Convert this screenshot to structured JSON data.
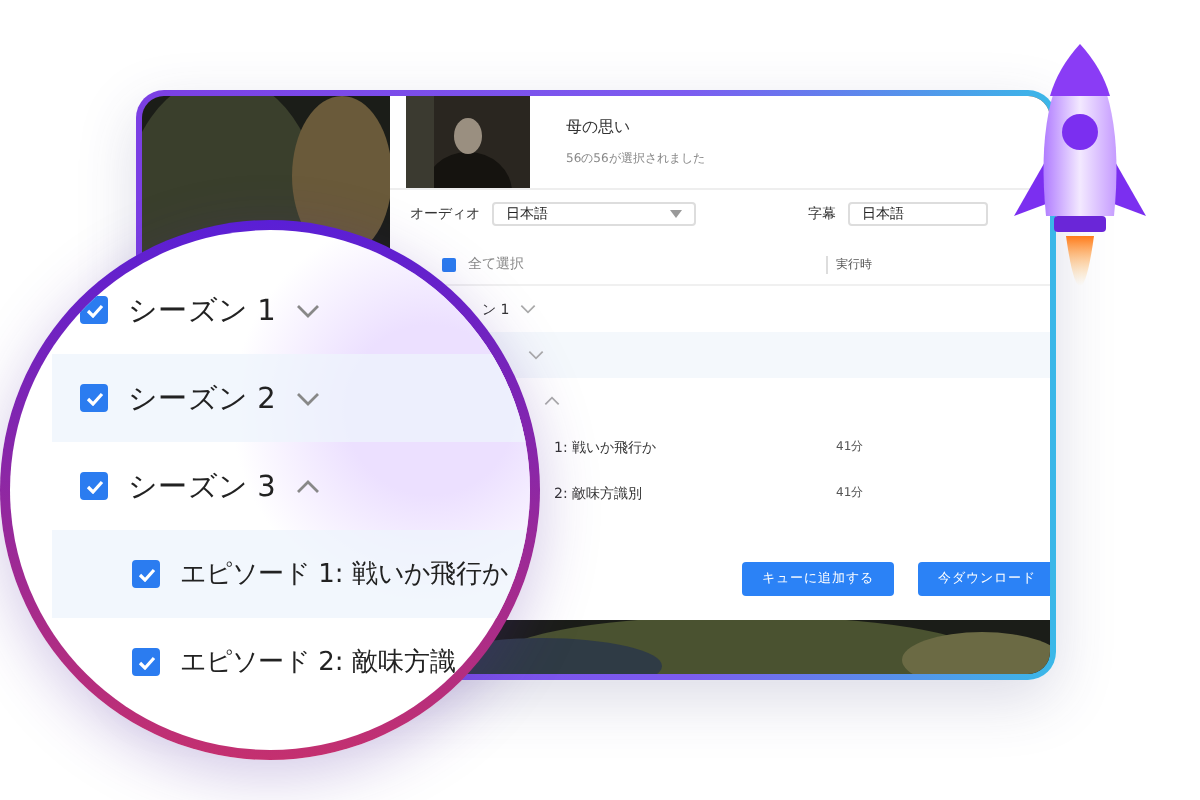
{
  "window": {
    "title": "母の思い",
    "subtitle": "56の56が選択されました",
    "audio": {
      "label": "オーディオ",
      "value": "日本語"
    },
    "subtitles": {
      "label": "字幕",
      "value": "日本語"
    },
    "select_all": {
      "label": "全て選択",
      "checked": true
    },
    "column": "実行時",
    "rows": [
      {
        "kind": "season",
        "label": "ン 1",
        "expanded": false
      },
      {
        "kind": "season",
        "expanded": false
      },
      {
        "kind": "season",
        "expanded": true
      },
      {
        "kind": "episode",
        "label": "1: 戦いか飛行か",
        "runtime": "41分"
      },
      {
        "kind": "episode",
        "label": "2: 敵味方識別",
        "runtime": "41分"
      }
    ],
    "buttons": [
      "キューに追加する",
      "今ダウンロード"
    ]
  },
  "magnifier": {
    "rows": [
      {
        "kind": "season",
        "label": "シーズン 1",
        "checked": true,
        "expanded": false
      },
      {
        "kind": "season",
        "label": "シーズン 2",
        "checked": true,
        "expanded": false
      },
      {
        "kind": "season",
        "label": "シーズン 3",
        "checked": true,
        "expanded": true
      },
      {
        "kind": "episode",
        "label": "エピソード 1: 戦いか飛行か",
        "checked": true
      },
      {
        "kind": "episode",
        "label": "エピソード 2: 敵味方識",
        "checked": true
      }
    ]
  }
}
